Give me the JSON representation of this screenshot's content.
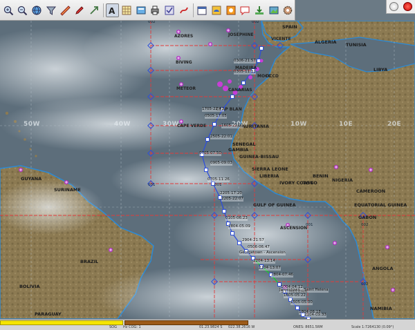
{
  "toolbar": {
    "buttons": [
      {
        "name": "zoom-in-icon",
        "active": false
      },
      {
        "name": "zoom-out-icon",
        "active": false
      },
      {
        "name": "globe-icon",
        "active": false
      },
      {
        "name": "funnel-icon",
        "active": false
      },
      {
        "name": "ruler-icon",
        "active": false
      },
      {
        "name": "pencil-icon",
        "active": false
      },
      {
        "name": "arrow-icon",
        "active": false
      },
      {
        "name": "text-tool-icon",
        "active": true
      },
      {
        "name": "grid-icon",
        "active": false
      },
      {
        "name": "layers-icon",
        "active": false
      },
      {
        "name": "print-icon",
        "active": false
      },
      {
        "name": "checklist-icon",
        "active": false
      },
      {
        "name": "route-icon",
        "active": false
      },
      {
        "name": "calendar-icon",
        "active": false
      },
      {
        "name": "weather-icon",
        "active": false
      },
      {
        "name": "radar-icon",
        "active": false
      },
      {
        "name": "chat-icon",
        "active": false
      },
      {
        "name": "download-icon",
        "active": false
      },
      {
        "name": "photo-icon",
        "active": false
      },
      {
        "name": "gear-icon",
        "active": false
      }
    ]
  },
  "map": {
    "regions": [
      "SPAIN",
      "ALGERIA",
      "TUNISIA",
      "LIBYA",
      "MAURITANIA",
      "SENEGAL",
      "GAMBIA",
      "GUINEA-BISSAU",
      "SIERRA LEONE",
      "LIBERIA",
      "IVORY COAST",
      "TOGO",
      "BENIN",
      "NIGERIA",
      "CAMEROON",
      "EQUATORIAL GUINEA",
      "GABON",
      "ANGOLA",
      "NAMIBIA",
      "GUYANA",
      "SURINAME",
      "BRAZIL",
      "BOLIVIA",
      "PARAGUAY",
      "GULF OF GUINEA"
    ],
    "places": [
      "AZORES",
      "JOSEPHINE",
      "BIVING",
      "METEOR",
      "CAPE VERDE",
      "ST. HELENA",
      "ASCENSION",
      "MADEIRA",
      "CANARIAS",
      "CEAP BLAN",
      "VICENTE",
      "MOCC",
      "OCCD"
    ],
    "latlon": [
      "50W",
      "40W",
      "30W",
      "20W",
      "10W",
      "10E",
      "20E"
    ],
    "grid_codes": [
      "002",
      "001",
      "002",
      "001",
      "002",
      "001",
      "002"
    ],
    "track_labels": [
      "0306-21:57",
      "0305-11:31",
      "1705-22:41",
      "0505-17:05",
      "1605-22:01",
      "2505-22:01",
      "0705-07:50",
      "0905-09:03",
      "0705-11:26",
      "2205-17:20",
      "2205-22:07",
      "0105-06:23",
      "2804-05:09",
      "2904-21:57",
      "0506-06:47",
      "Georgetown - Ascension",
      "2204-13:14",
      "2104-13:07",
      "2804-07:46",
      "1004-04:12",
      "1605-05:22",
      "1505-05:00",
      "1804-06:18",
      "2104-09:33",
      "Jamestown - Saint Helena"
    ],
    "track_color": "#2f4fd8",
    "highlight_track_color": "#22c13a",
    "grid_color": "#e23a3a"
  },
  "status": {
    "progress_yellow_fraction": 1.0,
    "progress_brown_fraction": 1.0,
    "items": [
      "SOG",
      "Hz COG: 1",
      "01.23.9824 S",
      "022.38.2616 W",
      "ONES: 8651.5RM",
      "Scale 1:7264130 (0.09°)"
    ]
  }
}
